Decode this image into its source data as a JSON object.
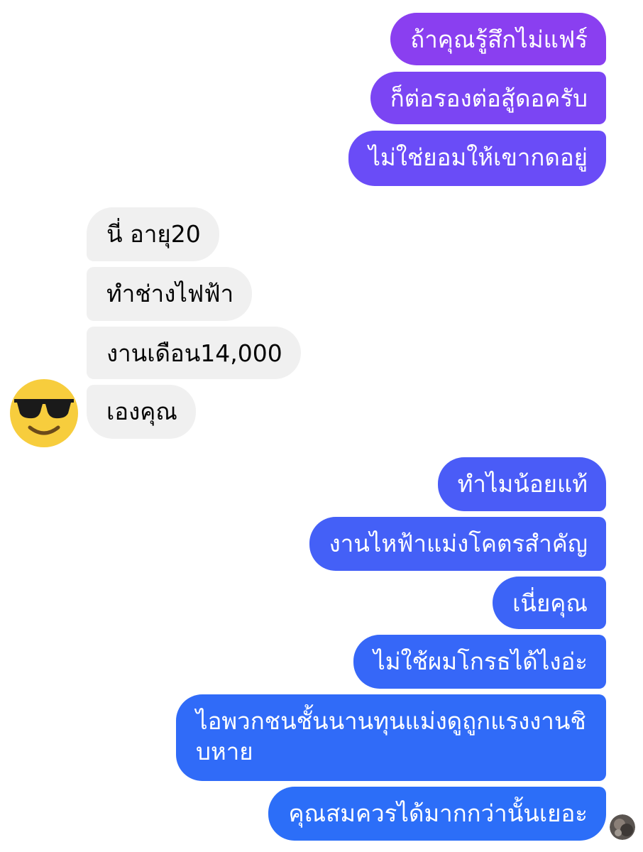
{
  "conversation": {
    "sent_group_1": [
      "ถ้าคุณรู้สึกไม่แฟร์",
      "ก็ต่อรองต่อสู้ดอครับ",
      "ไม่ใช่ยอมให้เขากดอยู่"
    ],
    "received_group": [
      "นี่ อายุ20",
      "ทำช่างไฟฟ้า",
      "งานเดือน14,000",
      "เองคุณ"
    ],
    "sent_group_2": [
      "ทำไมน้อยแท้",
      "งานไหฟ้าแม่งโคตรสำคัญ",
      "เนี่ยคุณ",
      "ไม่ใช้ผมโกรธได้ไงอ่ะ",
      "ไอพวกชนชั้นนานทุนแม่งดูถูกแรงงานชิบหาย",
      "คุณสมควรได้มากกว่านั้นเยอะ"
    ]
  },
  "sender_emoji": "smiling-face-with-sunglasses",
  "colors": {
    "purple_top": "#8a3ff0",
    "purple_bottom": "#6a4cf7",
    "blue_top": "#4a5cf7",
    "blue_bottom": "#2c6ef8",
    "received_bg": "#f0f0f0",
    "emoji_yellow": "#f7cd3d"
  }
}
